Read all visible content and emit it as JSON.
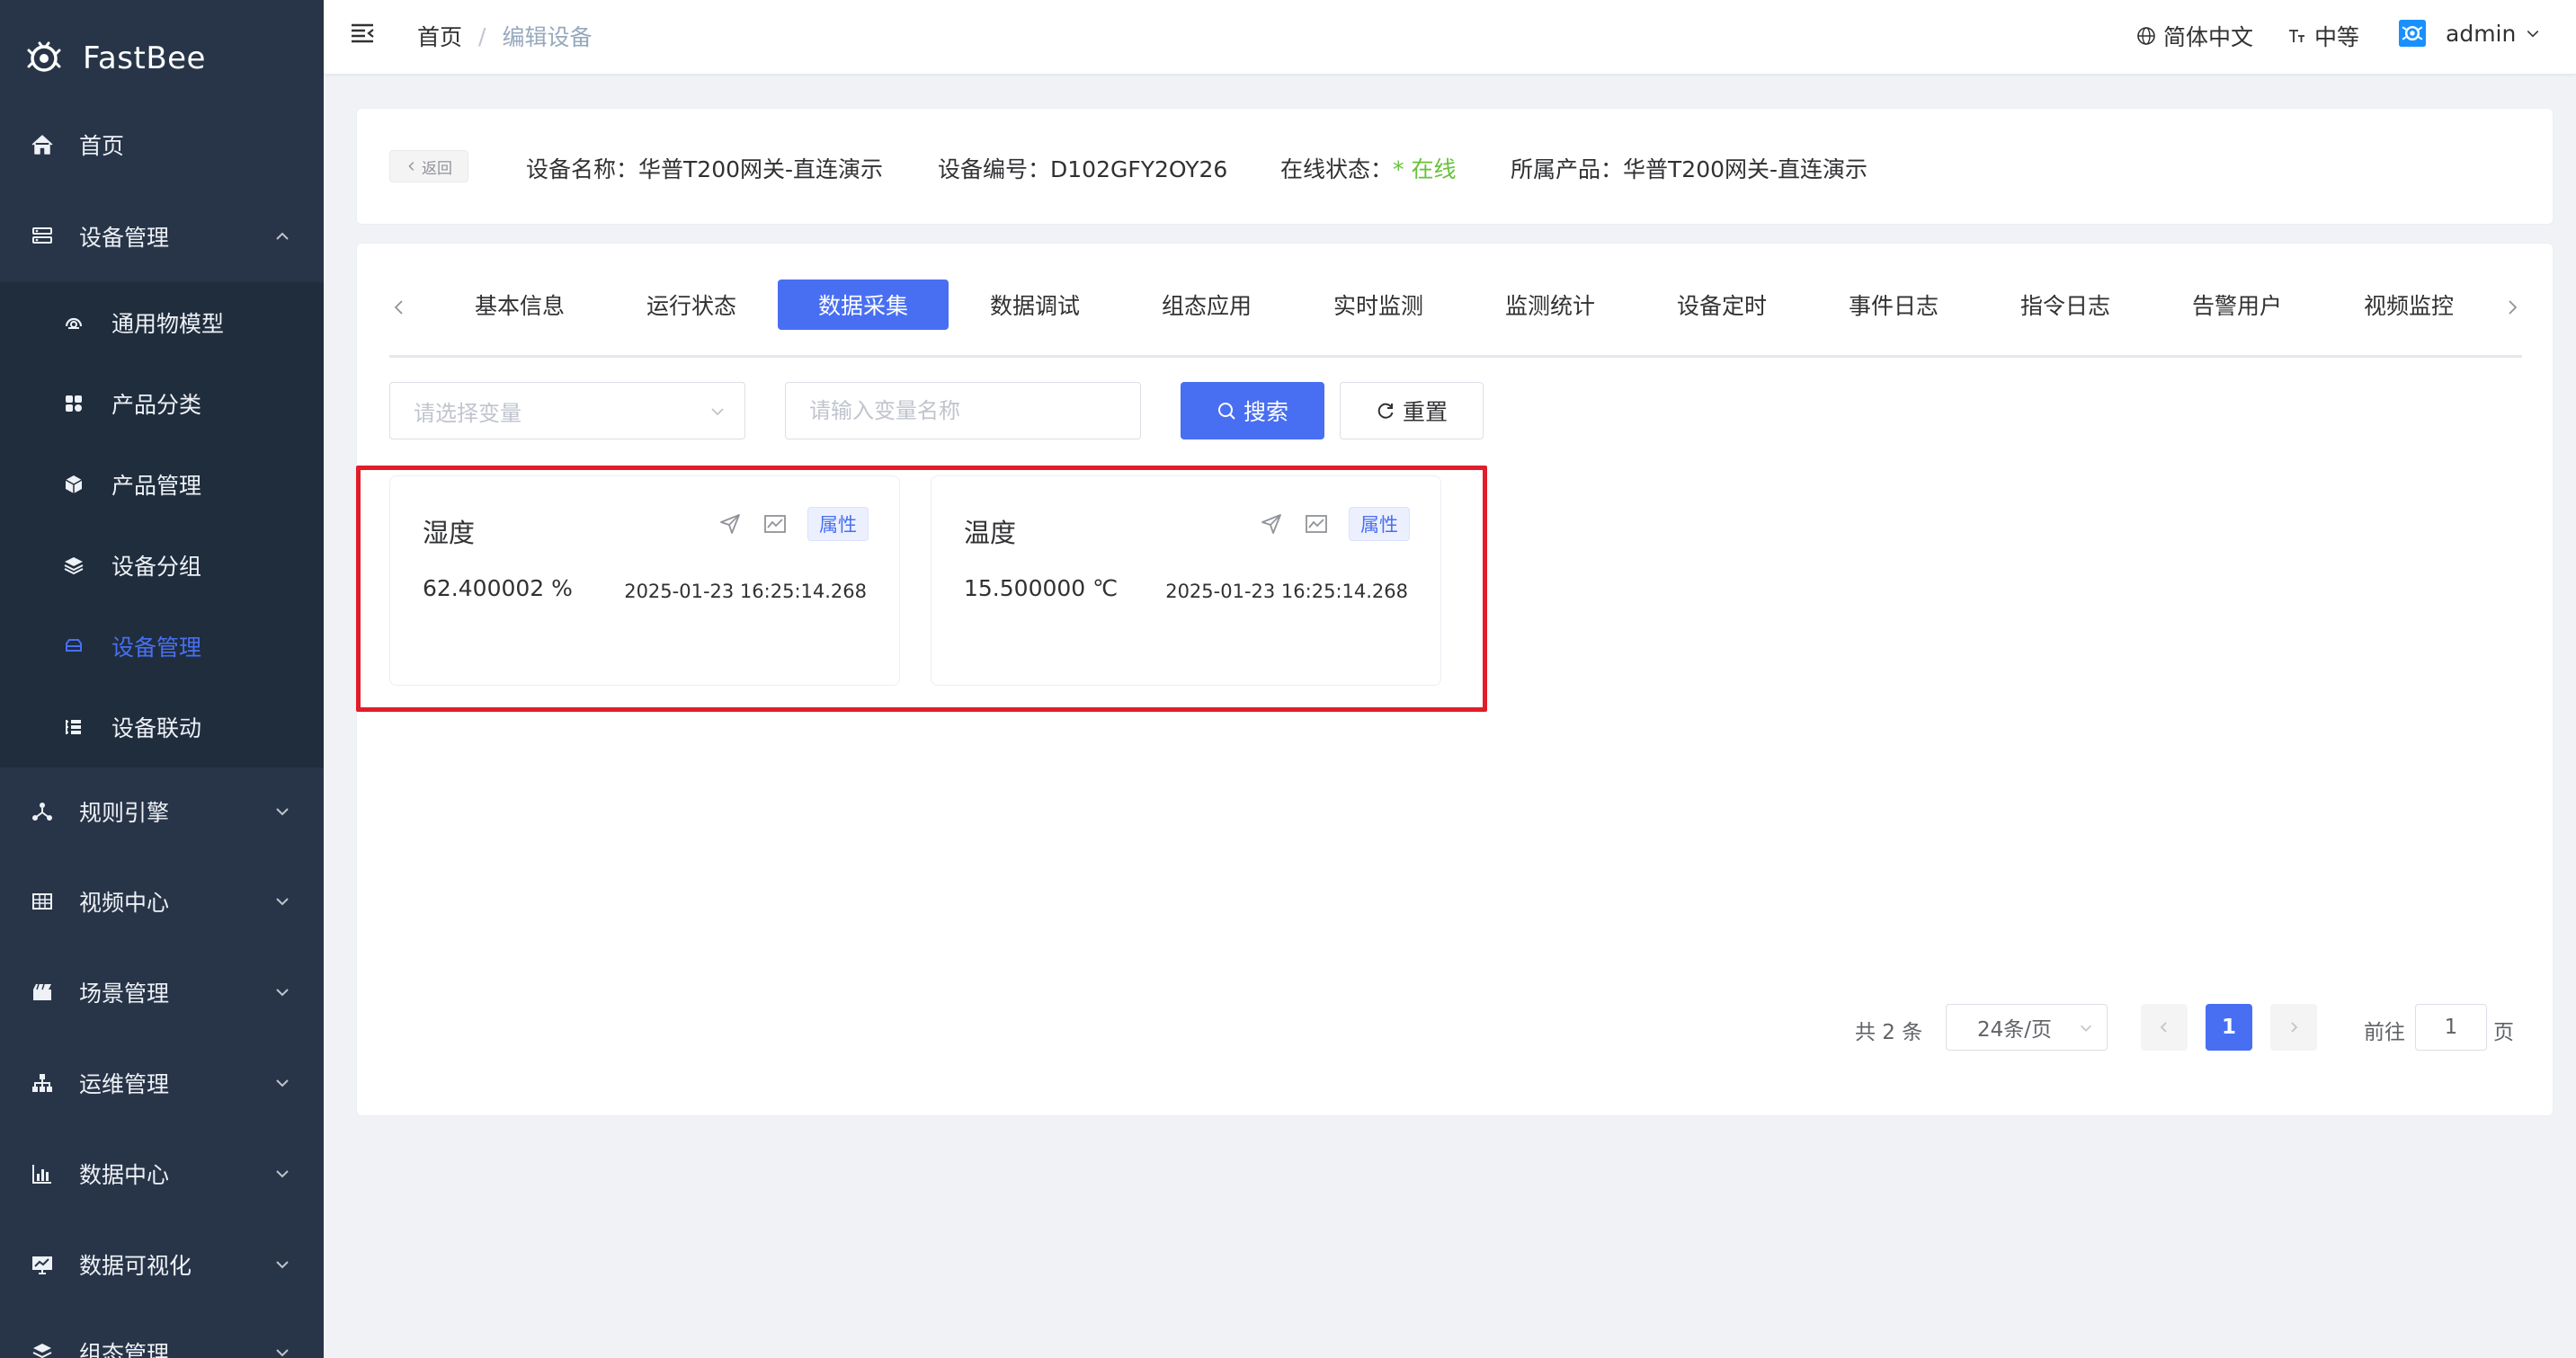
{
  "app": {
    "name": "FastBee"
  },
  "sidebar": {
    "items": [
      {
        "label": "首页",
        "icon": "home-icon"
      },
      {
        "label": "设备管理",
        "icon": "device-icon",
        "expanded": true
      },
      {
        "label": "规则引擎",
        "icon": "rule-icon"
      },
      {
        "label": "视频中心",
        "icon": "video-icon"
      },
      {
        "label": "场景管理",
        "icon": "scene-icon"
      },
      {
        "label": "运维管理",
        "icon": "ops-icon"
      },
      {
        "label": "数据中心",
        "icon": "chart-icon"
      },
      {
        "label": "数据可视化",
        "icon": "monitor-icon"
      },
      {
        "label": "组态管理",
        "icon": "layers-icon"
      }
    ],
    "subitems": [
      {
        "label": "通用物模型",
        "icon": "model-icon"
      },
      {
        "label": "产品分类",
        "icon": "category-icon"
      },
      {
        "label": "产品管理",
        "icon": "cube-icon"
      },
      {
        "label": "设备分组",
        "icon": "stack-icon"
      },
      {
        "label": "设备管理",
        "icon": "device-icon",
        "active": true
      },
      {
        "label": "设备联动",
        "icon": "list-icon"
      }
    ],
    "active_color": "#486ff2"
  },
  "header": {
    "breadcrumb": {
      "home": "首页",
      "sep": "/",
      "current": "编辑设备"
    },
    "language": "简体中文",
    "font_size": "中等",
    "user": "admin"
  },
  "device_info": {
    "back_label": "返回",
    "name_label": "设备名称：",
    "name_value": "华普T200网关-直连演示",
    "serial_label": "设备编号：",
    "serial_value": "D102GFY2OY26",
    "status_label": "在线状态：",
    "status_value": "* 在线",
    "product_label": "所属产品：",
    "product_value": "华普T200网关-直连演示",
    "online_color": "#67c23a"
  },
  "tabs": [
    {
      "label": "基本信息"
    },
    {
      "label": "运行状态"
    },
    {
      "label": "数据采集",
      "active": true
    },
    {
      "label": "数据调试"
    },
    {
      "label": "组态应用"
    },
    {
      "label": "实时监测"
    },
    {
      "label": "监测统计"
    },
    {
      "label": "设备定时"
    },
    {
      "label": "事件日志"
    },
    {
      "label": "指令日志"
    },
    {
      "label": "告警用户"
    },
    {
      "label": "视频监控"
    }
  ],
  "filters": {
    "variable_select_placeholder": "请选择变量",
    "variable_name_placeholder": "请输入变量名称",
    "search_label": "搜索",
    "reset_label": "重置"
  },
  "data_cards": [
    {
      "name": "湿度",
      "value": "62.400002 %",
      "time": "2025-01-23 16:25:14.268",
      "tag": "属性"
    },
    {
      "name": "温度",
      "value": "15.500000 ℃",
      "time": "2025-01-23 16:25:14.268",
      "tag": "属性"
    }
  ],
  "pagination": {
    "total": "共 2 条",
    "page_size": "24条/页",
    "current_page": "1",
    "goto_label": "前往",
    "goto_value": "1",
    "page_suffix": "页"
  },
  "colors": {
    "primary": "#486ff2",
    "sidebar_bg": "#283548",
    "highlight": "#e11d2a"
  }
}
